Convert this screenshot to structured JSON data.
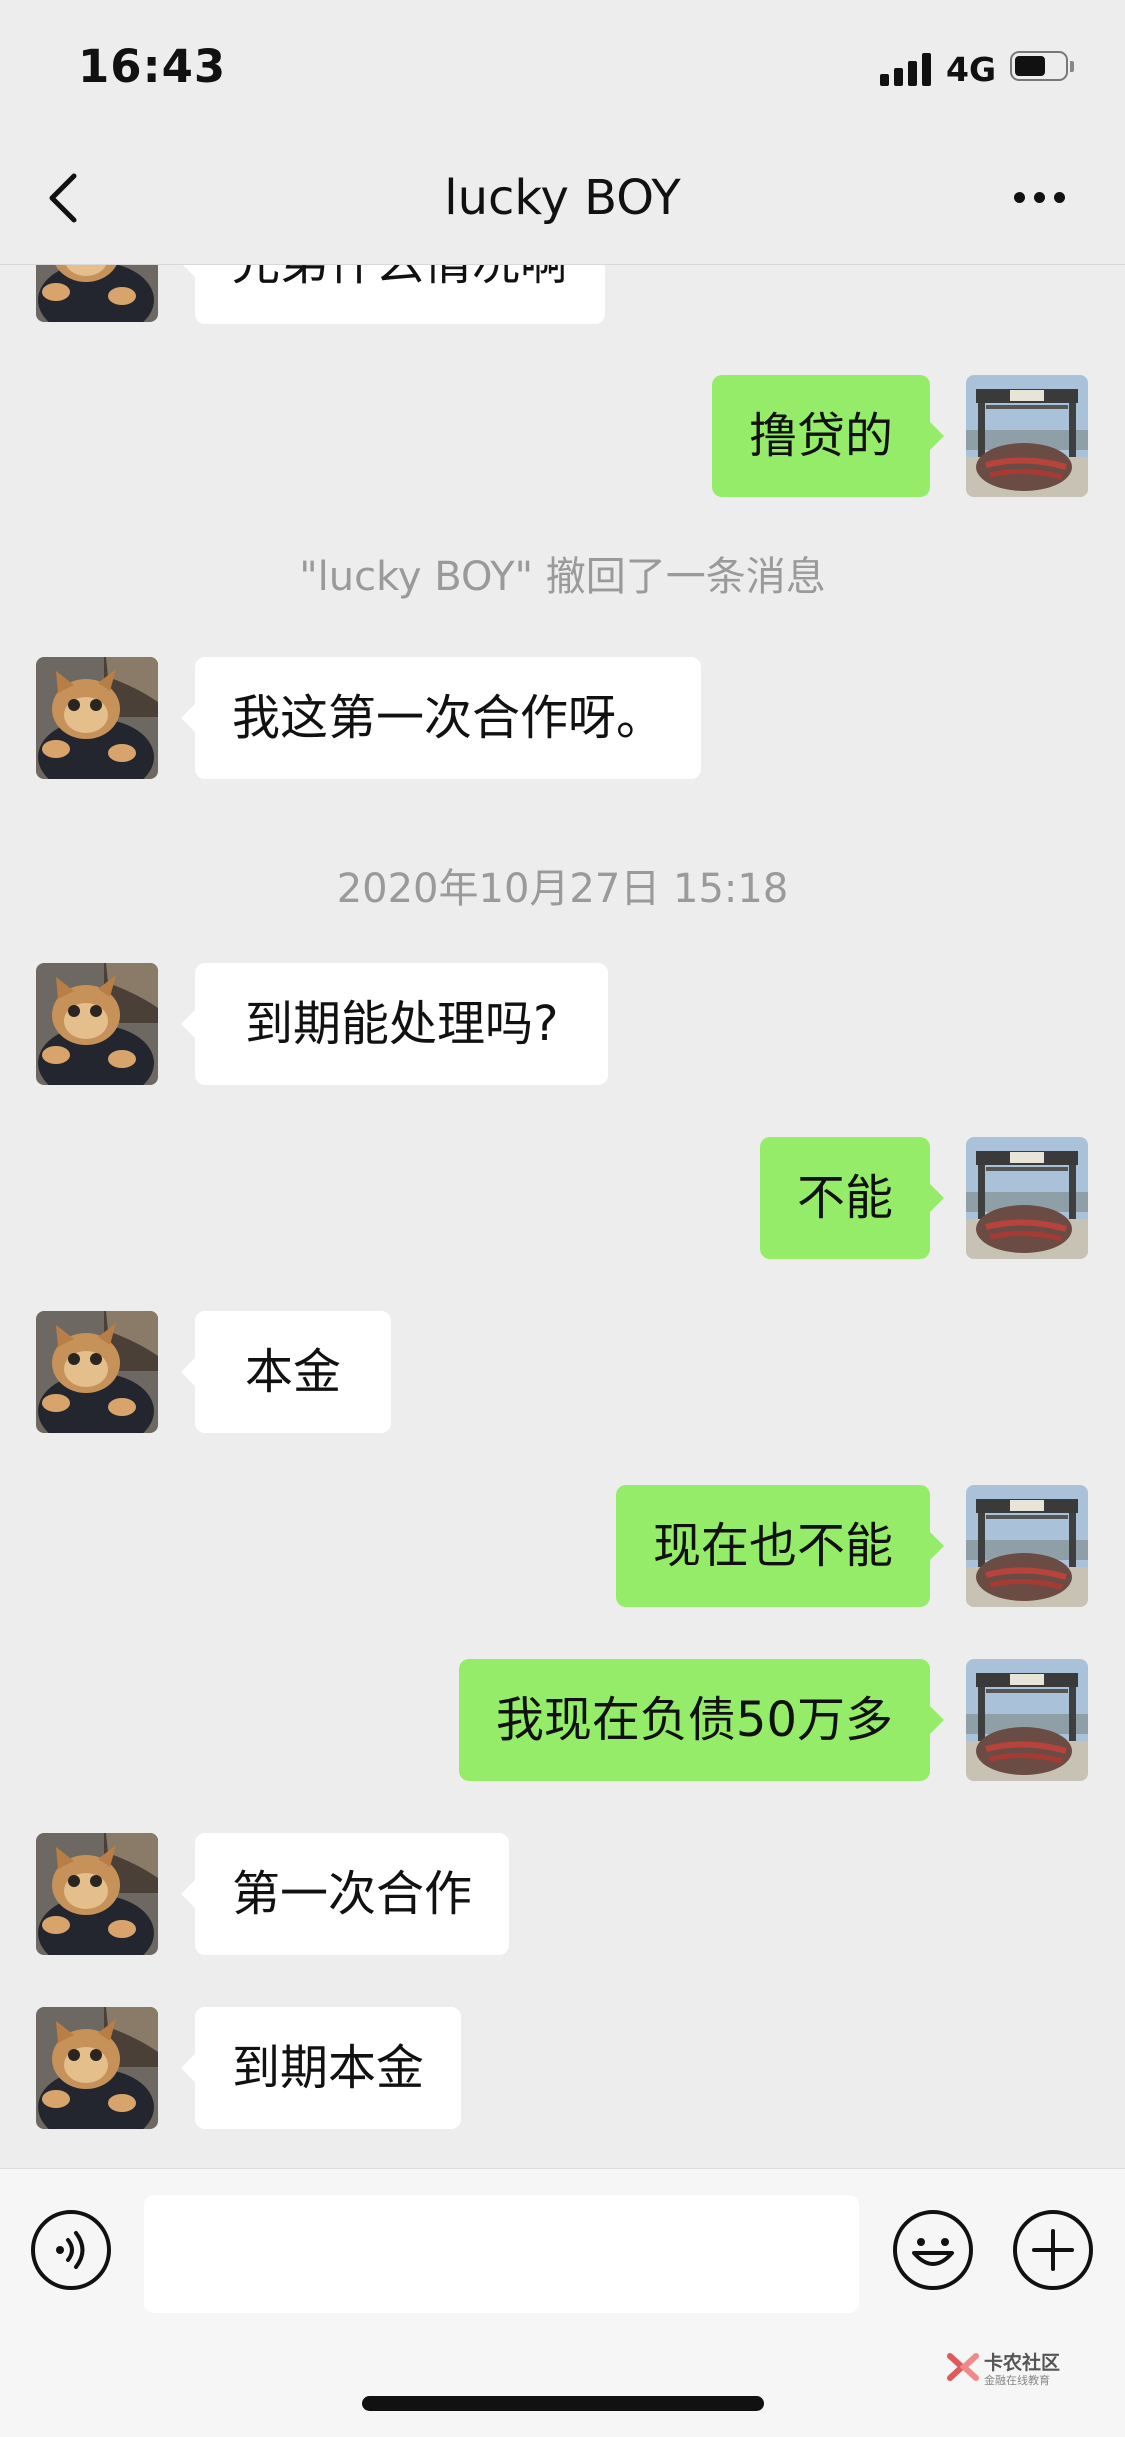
{
  "status_bar": {
    "time": "16:43",
    "network": "4G"
  },
  "nav": {
    "title": "lucky BOY"
  },
  "messages": {
    "m0": "兄弟什么情况啊",
    "m1": "撸贷的",
    "recall": "\"lucky BOY\" 撤回了一条消息",
    "m2": "我这第一次合作呀。",
    "timestamp": "2020年10月27日 15:18",
    "m3": "到期能处理吗?",
    "m4": "不能",
    "m5": "本金",
    "m6": "现在也不能",
    "m7": "我现在负债50万多",
    "m8": "第一次合作",
    "m9": "到期本金"
  },
  "watermark": {
    "line1": "卡农社区",
    "line2": "金融在线教育"
  },
  "colors": {
    "background": "#ededed",
    "incoming_bubble": "#ffffff",
    "outgoing_bubble": "#95ec69",
    "system_text": "#9a9a9a"
  },
  "icons": {
    "back": "chevron-left-icon",
    "more": "more-dots-icon",
    "voice": "voice-icon",
    "emoji": "emoji-icon",
    "plus": "plus-icon"
  }
}
